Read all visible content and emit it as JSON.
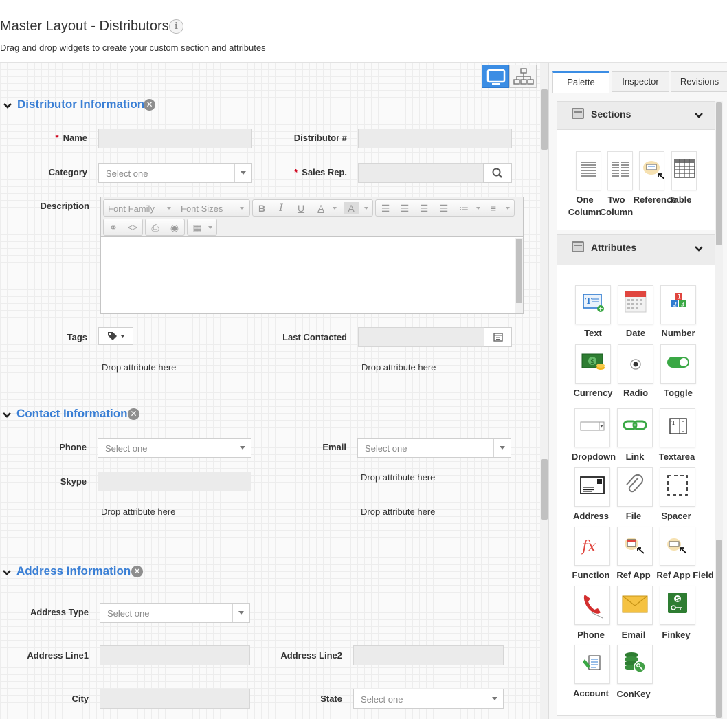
{
  "header": {
    "title": "Master Layout - Distributors",
    "subtitle": "Drag and drop widgets to create your custom section and attributes"
  },
  "sections": {
    "distributor": {
      "title": "Distributor Information",
      "name_label": "Name",
      "distributor_no_label": "Distributor #",
      "category_label": "Category",
      "category_value": "Select one",
      "sales_rep_label": "Sales Rep.",
      "description_label": "Description",
      "tags_label": "Tags",
      "last_contacted_label": "Last Contacted",
      "drop_left": "Drop attribute here",
      "drop_right": "Drop attribute here"
    },
    "contact": {
      "title": "Contact Information",
      "phone_label": "Phone",
      "phone_value": "Select one",
      "email_label": "Email",
      "email_value": "Select one",
      "skype_label": "Skype",
      "drop_right_1": "Drop attribute here",
      "drop_left": "Drop attribute here",
      "drop_right_2": "Drop attribute here"
    },
    "address": {
      "title": "Address Information",
      "address_type_label": "Address Type",
      "address_type_value": "Select one",
      "line1_label": "Address Line1",
      "line2_label": "Address Line2",
      "city_label": "City",
      "state_label": "State",
      "state_value": "Select one"
    }
  },
  "editor": {
    "font_family": "Font Family",
    "font_sizes": "Font Sizes"
  },
  "panel": {
    "tabs": {
      "palette": "Palette",
      "inspector": "Inspector",
      "revisions": "Revisions"
    },
    "sections_title": "Sections",
    "section_widgets": [
      {
        "line1": "One",
        "line2": "Column"
      },
      {
        "line1": "Two",
        "line2": "Column"
      },
      {
        "line1": "Reference",
        "line2": ""
      },
      {
        "line1": "Table",
        "line2": ""
      }
    ],
    "attributes_title": "Attributes",
    "attributes": [
      "Text",
      "Date",
      "Number",
      "Currency",
      "Radio",
      "Toggle",
      "Dropdown",
      "Link",
      "Textarea",
      "Address",
      "File",
      "Spacer",
      "Function",
      "Ref App",
      "Ref App Field",
      "Phone",
      "Email",
      "Finkey",
      "Account",
      "ConKey"
    ]
  },
  "colors": {
    "accent": "#3a7fd5",
    "required": "#d0021b",
    "active_view": "#3b8de4"
  }
}
